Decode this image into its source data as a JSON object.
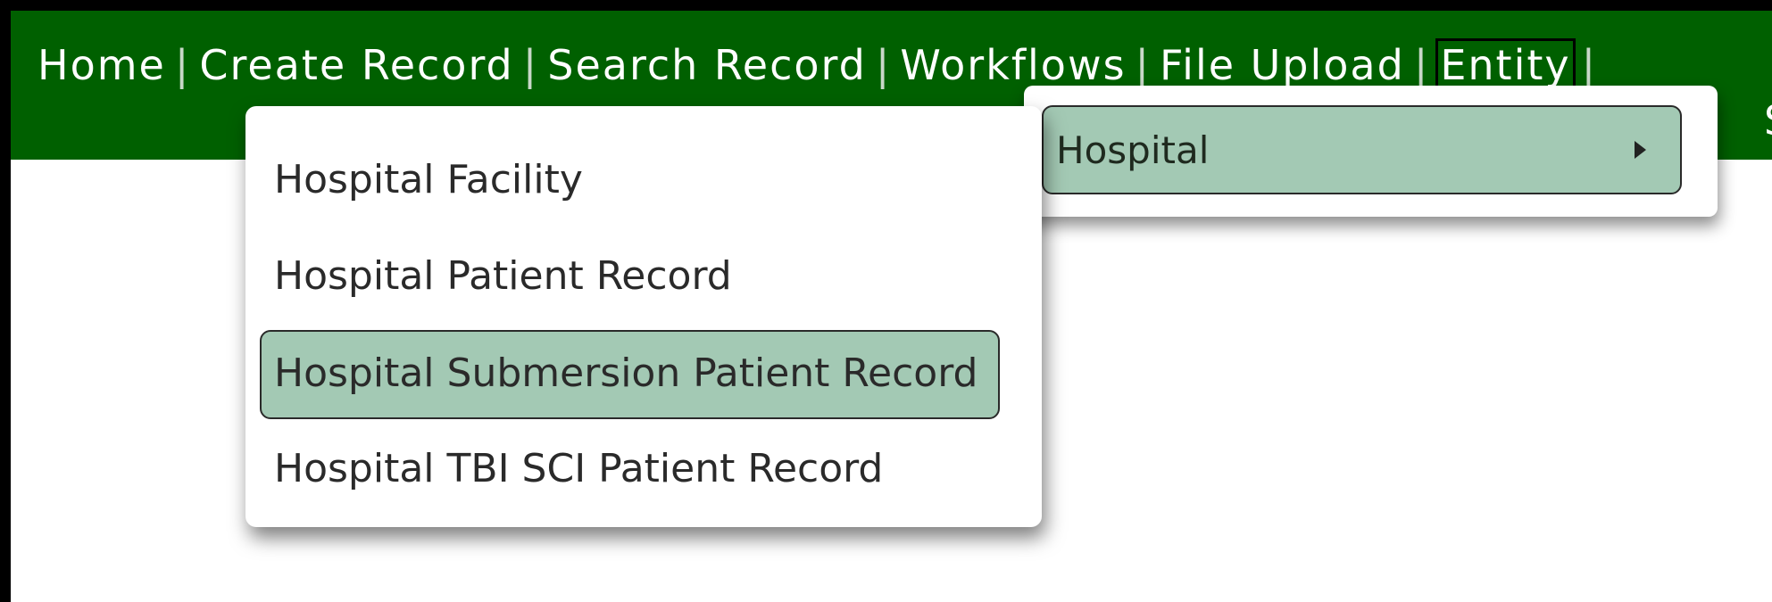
{
  "nav": {
    "links": [
      {
        "label": "Home"
      },
      {
        "label": "Create Record"
      },
      {
        "label": "Search Record"
      },
      {
        "label": "Workflows"
      },
      {
        "label": "File Upload"
      },
      {
        "label": "Entity"
      }
    ],
    "separator": "|",
    "active_link": "Entity",
    "extra_fragment": "S"
  },
  "entity_menu": {
    "items": [
      {
        "label": "Hospital",
        "has_submenu": true,
        "icon": "caret-right-icon"
      }
    ]
  },
  "hospital_submenu": {
    "items": [
      {
        "label": "Hospital Facility"
      },
      {
        "label": "Hospital Patient Record"
      },
      {
        "label": "Hospital Submersion Patient Record",
        "highlighted": true
      },
      {
        "label": "Hospital TBI SCI Patient Record"
      }
    ]
  },
  "colors": {
    "navbar_bg": "#006000",
    "highlight_bg": "#a3c9b4",
    "nav_text": "#ffffff"
  }
}
